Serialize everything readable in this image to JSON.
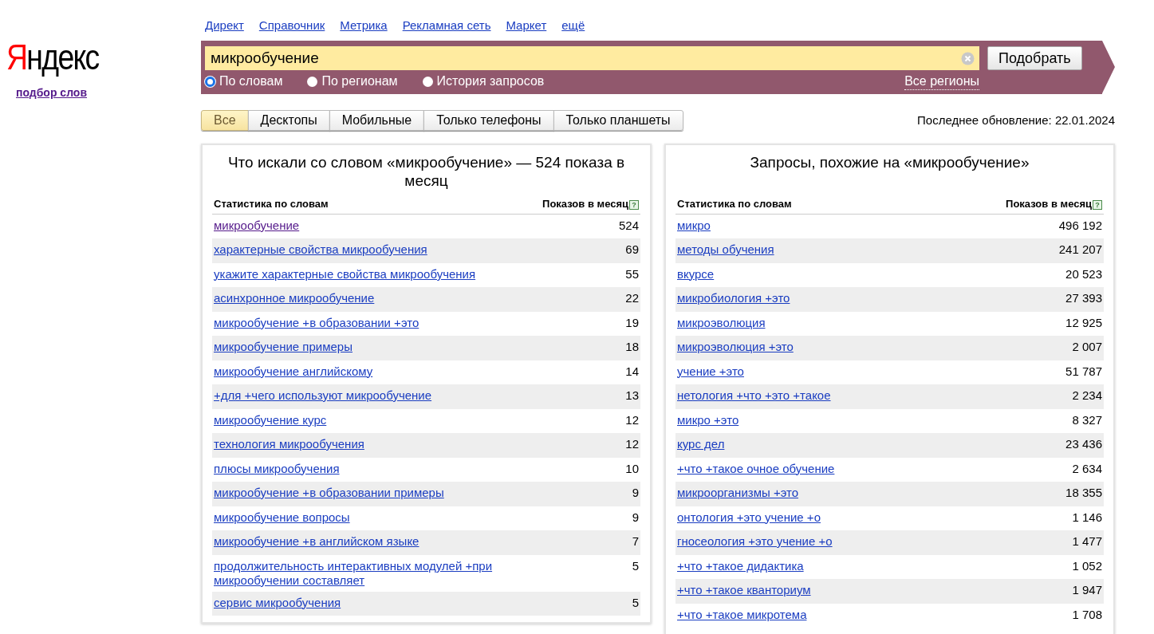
{
  "logo": {
    "text": "Яндекс",
    "subtitle": "подбор слов"
  },
  "nav_links": [
    "Директ",
    "Справочник",
    "Метрика",
    "Рекламная сеть",
    "Маркет",
    "ещё"
  ],
  "search": {
    "value": "микрообучение",
    "button": "Подобрать",
    "region_link": "Все регионы"
  },
  "modes": [
    {
      "label": "По словам",
      "selected": true
    },
    {
      "label": "По регионам",
      "selected": false
    },
    {
      "label": "История запросов",
      "selected": false
    }
  ],
  "device_tabs": [
    {
      "label": "Все",
      "selected": true
    },
    {
      "label": "Десктопы",
      "selected": false
    },
    {
      "label": "Мобильные",
      "selected": false
    },
    {
      "label": "Только телефоны",
      "selected": false
    },
    {
      "label": "Только планшеты",
      "selected": false
    }
  ],
  "last_update": "Последнее обновление: 22.01.2024",
  "panels": [
    {
      "title": "Что искали со словом «микрообучение» — 524 показа в месяц",
      "col_phrase": "Статистика по словам",
      "col_count": "Показов в месяц",
      "help": "?",
      "rows": [
        {
          "phrase": "микрообучение",
          "count": "524",
          "visited": true
        },
        {
          "phrase": "характерные свойства микрообучения",
          "count": "69",
          "visited": false
        },
        {
          "phrase": "укажите характерные свойства микрообучения",
          "count": "55",
          "visited": false
        },
        {
          "phrase": "асинхронное микрообучение",
          "count": "22",
          "visited": false
        },
        {
          "phrase": "микрообучение +в образовании +это",
          "count": "19",
          "visited": false
        },
        {
          "phrase": "микрообучение примеры",
          "count": "18",
          "visited": false
        },
        {
          "phrase": "микрообучение английскому",
          "count": "14",
          "visited": false
        },
        {
          "phrase": "+для +чего используют микрообучение",
          "count": "13",
          "visited": false
        },
        {
          "phrase": "микрообучение курс",
          "count": "12",
          "visited": false
        },
        {
          "phrase": "технология микрообучения",
          "count": "12",
          "visited": false
        },
        {
          "phrase": "плюсы микрообучения",
          "count": "10",
          "visited": false
        },
        {
          "phrase": "микрообучение +в образовании примеры",
          "count": "9",
          "visited": false
        },
        {
          "phrase": "микрообучение вопросы",
          "count": "9",
          "visited": false
        },
        {
          "phrase": "микрообучение +в английском языке",
          "count": "7",
          "visited": false
        },
        {
          "phrase": "продолжительность интерактивных модулей +при микрообучении составляет",
          "count": "5",
          "visited": false
        },
        {
          "phrase": "сервис микрообучения",
          "count": "5",
          "visited": false
        }
      ]
    },
    {
      "title": "Запросы, похожие на «микрообучение»",
      "col_phrase": "Статистика по словам",
      "col_count": "Показов в месяц",
      "help": "?",
      "rows": [
        {
          "phrase": "микро",
          "count": "496 192",
          "visited": false
        },
        {
          "phrase": "методы обучения",
          "count": "241 207",
          "visited": false
        },
        {
          "phrase": "вкурсе",
          "count": "20 523",
          "visited": false
        },
        {
          "phrase": "микробиология +это",
          "count": "27 393",
          "visited": false
        },
        {
          "phrase": "микроэволюция",
          "count": "12 925",
          "visited": false
        },
        {
          "phrase": "микроэволюция +это",
          "count": "2 007",
          "visited": false
        },
        {
          "phrase": "учение +это",
          "count": "51 787",
          "visited": false
        },
        {
          "phrase": "нетология +что +это +такое",
          "count": "2 234",
          "visited": false
        },
        {
          "phrase": "микро +это",
          "count": "8 327",
          "visited": false
        },
        {
          "phrase": "курс дел",
          "count": "23 436",
          "visited": false
        },
        {
          "phrase": "+что +такое очное обучение",
          "count": "2 634",
          "visited": false
        },
        {
          "phrase": "микроорганизмы +это",
          "count": "18 355",
          "visited": false
        },
        {
          "phrase": "онтология +это учение +о",
          "count": "1 146",
          "visited": false
        },
        {
          "phrase": "гносеология +это учение +о",
          "count": "1 477",
          "visited": false
        },
        {
          "phrase": "+что +такое дидактика",
          "count": "1 052",
          "visited": false
        },
        {
          "phrase": "+что +такое кванториум",
          "count": "1 947",
          "visited": false
        },
        {
          "phrase": "+что +такое микротема",
          "count": "1 708",
          "visited": false
        }
      ]
    }
  ]
}
